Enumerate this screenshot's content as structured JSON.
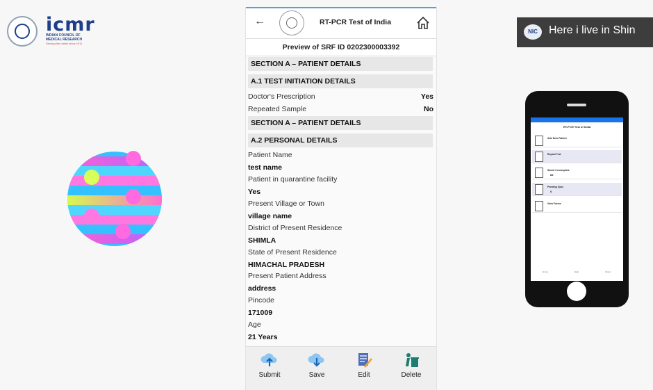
{
  "logo": {
    "wordmark": "icmr",
    "line1": "INDIAN COUNCIL OF",
    "line2": "MEDICAL RESEARCH",
    "tagline": "Serving the nation since 1911"
  },
  "app": {
    "title": "RT-PCR Test of India",
    "subtitle": "Preview of SRF ID 0202300003392"
  },
  "sections": {
    "s1": "SECTION A – PATIENT DETAILS",
    "a1": "A.1 TEST INITIATION DETAILS",
    "s2": "SECTION A – PATIENT DETAILS",
    "a2": "A.2 PERSONAL DETAILS"
  },
  "test_initiation": [
    {
      "label": "Doctor's Prescription",
      "value": "Yes"
    },
    {
      "label": "Repeated Sample",
      "value": "No"
    }
  ],
  "personal": [
    {
      "label": "Patient Name",
      "value": "test name"
    },
    {
      "label": "Patient in quarantine facility",
      "value": "Yes"
    },
    {
      "label": "Present Village or Town",
      "value": "village name"
    },
    {
      "label": "District of Present Residence",
      "value": "SHIMLA"
    },
    {
      "label": "State of Present Residence",
      "value": "HIMACHAL PRADESH"
    },
    {
      "label": "Present Patient Address",
      "value": "address"
    },
    {
      "label": "Pincode",
      "value": "171009"
    },
    {
      "label": "Age",
      "value": "21 Years"
    }
  ],
  "actions": [
    {
      "label": "Submit",
      "icon": "cloud-upload-icon"
    },
    {
      "label": "Save",
      "icon": "cloud-download-icon"
    },
    {
      "label": "Edit",
      "icon": "edit-document-icon"
    },
    {
      "label": "Delete",
      "icon": "trash-icon"
    }
  ],
  "banner": {
    "badge": "NIC",
    "text": "Here i live in Shin"
  },
  "mock_phone": {
    "title": "RT-PCR Test of India",
    "items": [
      {
        "label": "Add New Patient",
        "count": ""
      },
      {
        "label": "Repeat Test",
        "count": ""
      },
      {
        "label": "Saved / Incomplete",
        "count": "83"
      },
      {
        "label": "Pending Sync",
        "count": "0"
      },
      {
        "label": "View Forms",
        "count": ""
      }
    ],
    "nav": [
      "Home",
      "Help",
      "About"
    ]
  },
  "colors": {
    "accent": "#5c9cd8",
    "brand": "#1d3f8a",
    "section_bg": "#e7e7e7"
  }
}
